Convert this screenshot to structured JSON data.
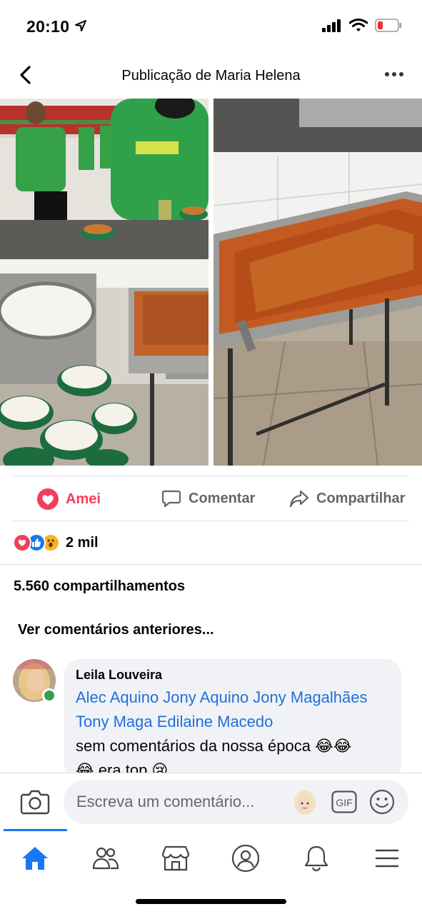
{
  "status_bar": {
    "time": "20:10",
    "icons": [
      "location-arrow-icon",
      "signal-icon",
      "wifi-icon",
      "battery-low-icon"
    ]
  },
  "header": {
    "title": "Publicação de Maria Helena",
    "back_icon": "chevron-left-icon",
    "more_icon": "more-horizontal-icon"
  },
  "post": {
    "actions": {
      "love_label": "Amei",
      "comment_label": "Comentar",
      "share_label": "Compartilhar"
    },
    "reactions": {
      "types": [
        "love",
        "like",
        "wow"
      ],
      "count": "2 mil"
    },
    "shares_text": "5.560 compartilhamentos",
    "view_previous": "Ver comentários anteriores..."
  },
  "comment": {
    "author": "Leila Louveira",
    "tags": "Alec Aquino Jony Aquino Jony Magalhães Tony Maga Edilaine Macedo",
    "text_line1": "sem comentários da nossa época 😂😂",
    "text_line2": "😂 era top 😢"
  },
  "composer": {
    "placeholder": "Escreva um comentário...",
    "gif_label": "GIF"
  },
  "colors": {
    "accent": "#1877f2",
    "love": "#f33e58",
    "link": "#216fdb",
    "bubble": "#f0f2f5",
    "online": "#31a24c"
  },
  "bottom_nav": [
    "home-icon",
    "friends-icon",
    "marketplace-icon",
    "profile-icon",
    "notifications-icon",
    "menu-icon"
  ]
}
